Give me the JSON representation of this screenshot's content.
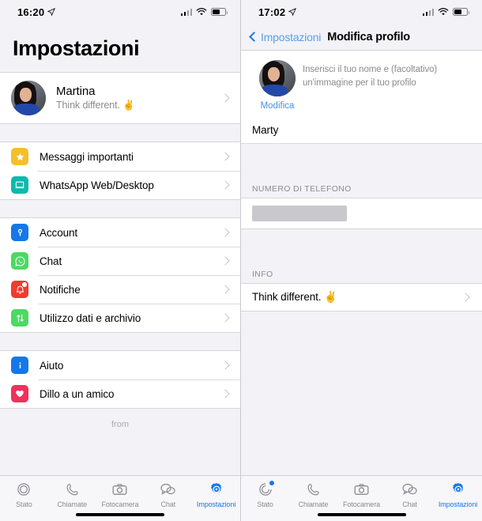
{
  "left": {
    "status": {
      "time": "16:20",
      "location_icon": "location-arrow-icon",
      "signal_icon": "signal-bars-icon",
      "wifi_icon": "wifi-icon",
      "battery_icon": "battery-icon"
    },
    "title": "Impostazioni",
    "profile": {
      "name": "Martina",
      "status": "Think different. ✌️",
      "avatar_alt": "avatar"
    },
    "groups": [
      {
        "items": [
          {
            "label": "Messaggi importanti",
            "icon": "star-icon",
            "color": "#f7be2c"
          },
          {
            "label": "WhatsApp Web/Desktop",
            "icon": "laptop-icon",
            "color": "#0eb8ae"
          }
        ]
      },
      {
        "items": [
          {
            "label": "Account",
            "icon": "key-icon",
            "color": "#1478e8"
          },
          {
            "label": "Chat",
            "icon": "whatsapp-icon",
            "color": "#4cd964"
          },
          {
            "label": "Notifiche",
            "icon": "bell-icon",
            "color": "#f33a2f"
          },
          {
            "label": "Utilizzo dati e archivio",
            "icon": "data-arrows-icon",
            "color": "#4cd964"
          }
        ]
      },
      {
        "items": [
          {
            "label": "Aiuto",
            "icon": "info-icon",
            "color": "#1478e8"
          },
          {
            "label": "Dillo a un amico",
            "icon": "heart-icon",
            "color": "#f0315c"
          }
        ]
      }
    ],
    "footer_note": "from",
    "tabs": [
      {
        "label": "Stato",
        "icon": "status-rings-icon",
        "active": false,
        "badge": false
      },
      {
        "label": "Chiamate",
        "icon": "phone-icon",
        "active": false,
        "badge": false
      },
      {
        "label": "Fotocamera",
        "icon": "camera-icon",
        "active": false,
        "badge": false
      },
      {
        "label": "Chat",
        "icon": "chat-bubbles-icon",
        "active": false,
        "badge": false
      },
      {
        "label": "Impostazioni",
        "icon": "gear-icon",
        "active": true,
        "badge": false
      }
    ]
  },
  "right": {
    "status": {
      "time": "17:02",
      "location_icon": "location-arrow-icon",
      "signal_icon": "signal-bars-icon",
      "wifi_icon": "wifi-icon",
      "battery_icon": "battery-icon"
    },
    "nav": {
      "back_label": "Impostazioni",
      "title": "Modifica profilo"
    },
    "edit": {
      "description": "Inserisci il tuo nome e (facoltativo) un'immagine per il tuo profilo",
      "edit_link": "Modifica",
      "name_value": "Marty"
    },
    "phone_section": {
      "header": "NUMERO DI TELEFONO",
      "value": ""
    },
    "info_section": {
      "header": "INFO",
      "value": "Think different. ✌️"
    },
    "tabs": [
      {
        "label": "Stato",
        "icon": "status-rings-icon",
        "active": false,
        "badge": true
      },
      {
        "label": "Chiamate",
        "icon": "phone-icon",
        "active": false,
        "badge": false
      },
      {
        "label": "Fotocamera",
        "icon": "camera-icon",
        "active": false,
        "badge": false
      },
      {
        "label": "Chat",
        "icon": "chat-bubbles-icon",
        "active": false,
        "badge": false
      },
      {
        "label": "Impostazioni",
        "icon": "gear-icon",
        "active": true,
        "badge": false
      }
    ]
  },
  "theme": {
    "accent": "#1478e8",
    "bg": "#f2f2f7",
    "card": "#ffffff",
    "muted": "#8c8c91"
  }
}
